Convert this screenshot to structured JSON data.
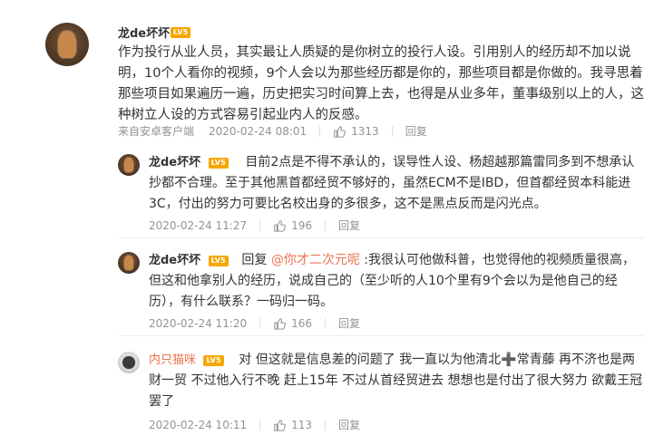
{
  "main": {
    "user": "龙de坏坏",
    "level": "LV5",
    "text": "作为投行从业人员，其实最让人质疑的是你树立的投行人设。引用别人的经历却不加以说明，10个人看你的视频，9个人会以为那些经历都是你的，那些项目都是你做的。我寻思着那些项目如果遍历一遍，历史把实习时间算上去，也得是从业多年，董事级别以上的人，这种树立人设的方式容易引起业内人的反感。",
    "source": "来自安卓客户端",
    "time": "2020-02-24 08:01",
    "likes": "1313",
    "reply_label": "回复"
  },
  "replies": [
    {
      "user": "龙de坏坏",
      "level": "LV5",
      "prefix": "",
      "mention": "",
      "text": "目前2点是不得不承认的，误导性人设、杨超越那篇雷同多到不想承认抄都不合理。至于其他黑首都经贸不够好的，虽然ECM不是IBD，但首都经贸本科能进3C，付出的努力可要比名校出身的多很多，这不是黑点反而是闪光点。",
      "time": "2020-02-24 11:27",
      "likes": "196",
      "reply_label": "回复"
    },
    {
      "user": "龙de坏坏",
      "level": "LV5",
      "prefix": "回复",
      "mention": "@你才二次元呢",
      "text": ":我很认可他做科普，也觉得他的视频质量很高，但这和他拿别人的经历，说成自己的（至少听的人10个里有9个会以为是他自己的经历），有什么联系？一码归一码。",
      "time": "2020-02-24 11:20",
      "likes": "166",
      "reply_label": "回复"
    },
    {
      "user": "内只猫咪",
      "level": "LV5",
      "prefix": "",
      "mention": "",
      "text": "对  但这就是信息差的问题了 我一直以为他清北➕常青藤  再不济也是两财一贸 不过他入行不晚 赶上15年 不过从首经贸进去 想想也是付出了很大努力  欲戴王冠罢了",
      "time": "2020-02-24 10:11",
      "likes": "113",
      "reply_label": "回复"
    }
  ],
  "colors": {
    "accent": "#eb7350",
    "badge": "#f7a600",
    "meta": "#939393",
    "text": "#333333"
  },
  "icons": {
    "like": "thumb-up-icon"
  }
}
